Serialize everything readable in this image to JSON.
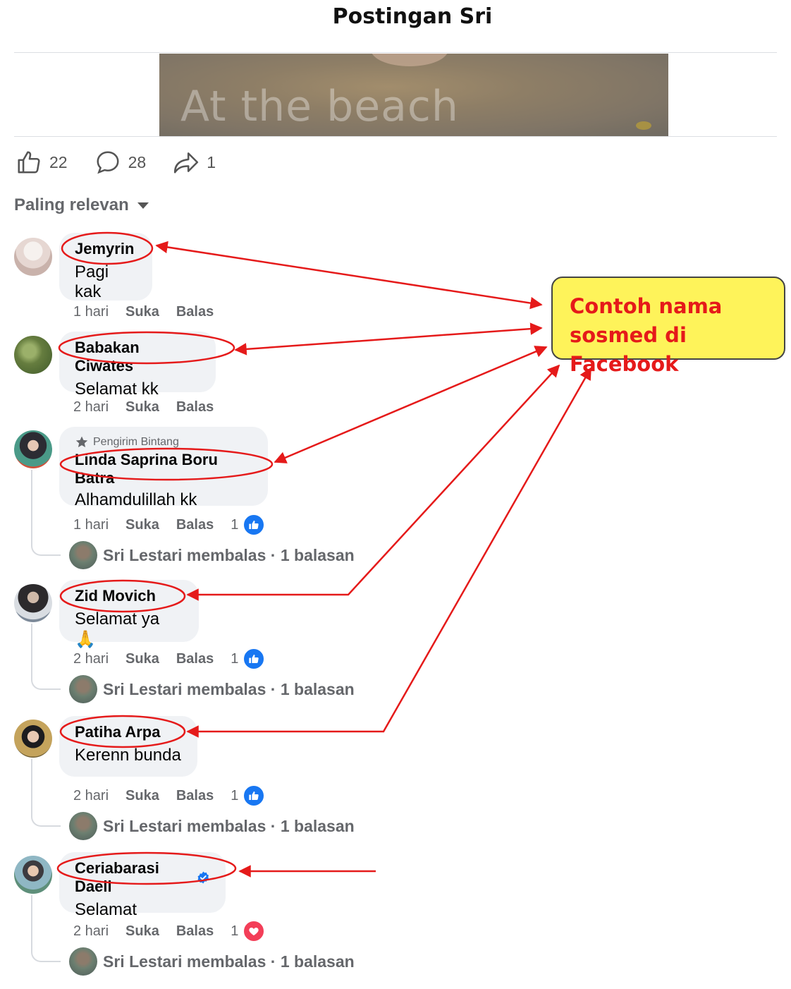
{
  "header": {
    "title": "Postingan Sri"
  },
  "post": {
    "image_caption": "At the beach",
    "stats": {
      "likes": "22",
      "comments": "28",
      "shares": "1"
    }
  },
  "sort": {
    "label": "Paling relevan"
  },
  "comments": [
    {
      "name": "Jemyrin",
      "text": "Pagi kak",
      "time": "1 hari",
      "like": "Suka",
      "reply": "Balas"
    },
    {
      "name": "Babakan Ciwates",
      "text": "Selamat kk",
      "time": "2 hari",
      "like": "Suka",
      "reply": "Balas"
    },
    {
      "badge": "Pengirim Bintang",
      "name": "Linda Saprina Boru Batra",
      "text": "Alhamdulillah kk",
      "time": "1 hari",
      "like": "Suka",
      "reply": "Balas",
      "reaction_count": "1",
      "reply_summary": "Sri Lestari membalas · 1 balasan"
    },
    {
      "name": "Zid Movich",
      "text": "Selamat ya 🙏",
      "time": "2 hari",
      "like": "Suka",
      "reply": "Balas",
      "reaction_count": "1",
      "reply_summary": "Sri Lestari membalas · 1 balasan"
    },
    {
      "name": "Patiha Arpa",
      "text": "Kerenn bunda",
      "time": "2 hari",
      "like": "Suka",
      "reply": "Balas",
      "reaction_count": "1",
      "reply_summary": "Sri Lestari membalas · 1 balasan"
    },
    {
      "name": "Ceriabarasi Daeli",
      "text": "Selamat",
      "time": "2 hari",
      "like": "Suka",
      "reply": "Balas",
      "reaction_count": "1",
      "reply_summary": "Sri Lestari membalas · 1 balasan"
    }
  ],
  "annotation": {
    "line1": "Contoh nama",
    "line2": "sosmed di Facebook"
  },
  "colors": {
    "annotation_red": "#e51a1a",
    "callout_bg": "#fef35a",
    "fb_blue": "#1877f2",
    "love_red": "#f33e58",
    "bubble_bg": "#f0f2f5"
  },
  "icons": [
    "like-icon",
    "comment-icon",
    "share-icon",
    "caret-down-icon",
    "star-icon",
    "verified-icon",
    "like-reaction-icon",
    "love-reaction-icon"
  ]
}
